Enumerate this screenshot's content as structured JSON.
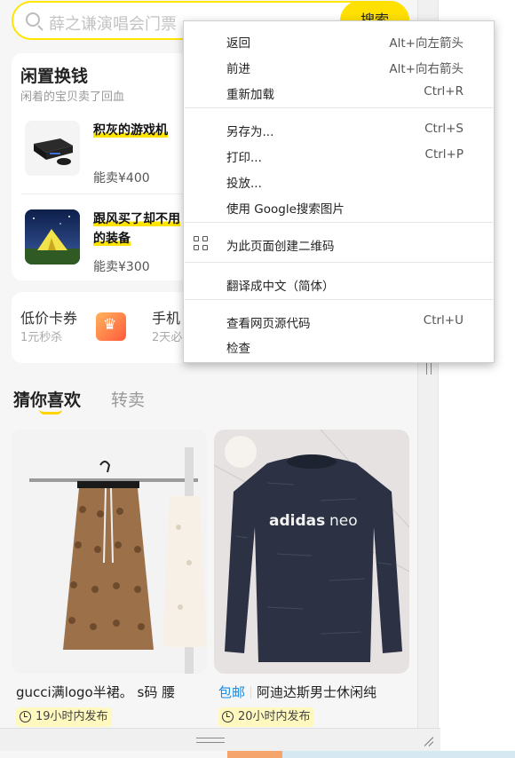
{
  "search": {
    "placeholder": "薛之谦演唱会门票",
    "button_label": "搜索"
  },
  "idle_section": {
    "title": "闲置换钱",
    "subtitle": "闲着的宝贝卖了回血",
    "items": [
      {
        "name": "积灰的游戏机",
        "price": "能卖¥400"
      },
      {
        "name": "跟风买了却不用的装备",
        "price": "能卖¥300"
      }
    ]
  },
  "coupon_section": {
    "left_title": "低价卡券",
    "left_sub": "1元秒杀",
    "right_title": "手机",
    "right_sub": "2天必"
  },
  "tabs": {
    "active": "猜你喜欢",
    "inactive": "转卖"
  },
  "products": [
    {
      "title": "gucci满logo半裙。 s码 腰",
      "tag": "",
      "time": "19小时内发布"
    },
    {
      "title": "阿迪达斯男士休闲纯",
      "tag": "包邮",
      "time": "20小时内发布"
    }
  ],
  "context_menu": {
    "groups": [
      [
        {
          "label": "返回",
          "shortcut": "Alt+向左箭头"
        },
        {
          "label": "前进",
          "shortcut": "Alt+向右箭头"
        },
        {
          "label": "重新加载",
          "shortcut": "Ctrl+R"
        }
      ],
      [
        {
          "label": "另存为...",
          "shortcut": "Ctrl+S"
        },
        {
          "label": "打印...",
          "shortcut": "Ctrl+P"
        },
        {
          "label": "投放...",
          "shortcut": ""
        },
        {
          "label": "使用 Google搜索图片",
          "shortcut": ""
        }
      ],
      [
        {
          "label": "为此页面创建二维码",
          "shortcut": "",
          "icon": "qr-code-icon"
        }
      ],
      [
        {
          "label": "翻译成中文（简体）",
          "shortcut": ""
        }
      ],
      [
        {
          "label": "查看网页源代码",
          "shortcut": "Ctrl+U"
        },
        {
          "label": "检查",
          "shortcut": ""
        }
      ]
    ]
  },
  "colors": {
    "accent_yellow": "#ffe500",
    "link_blue": "#1a8be0",
    "time_bg": "#fff8bf"
  }
}
